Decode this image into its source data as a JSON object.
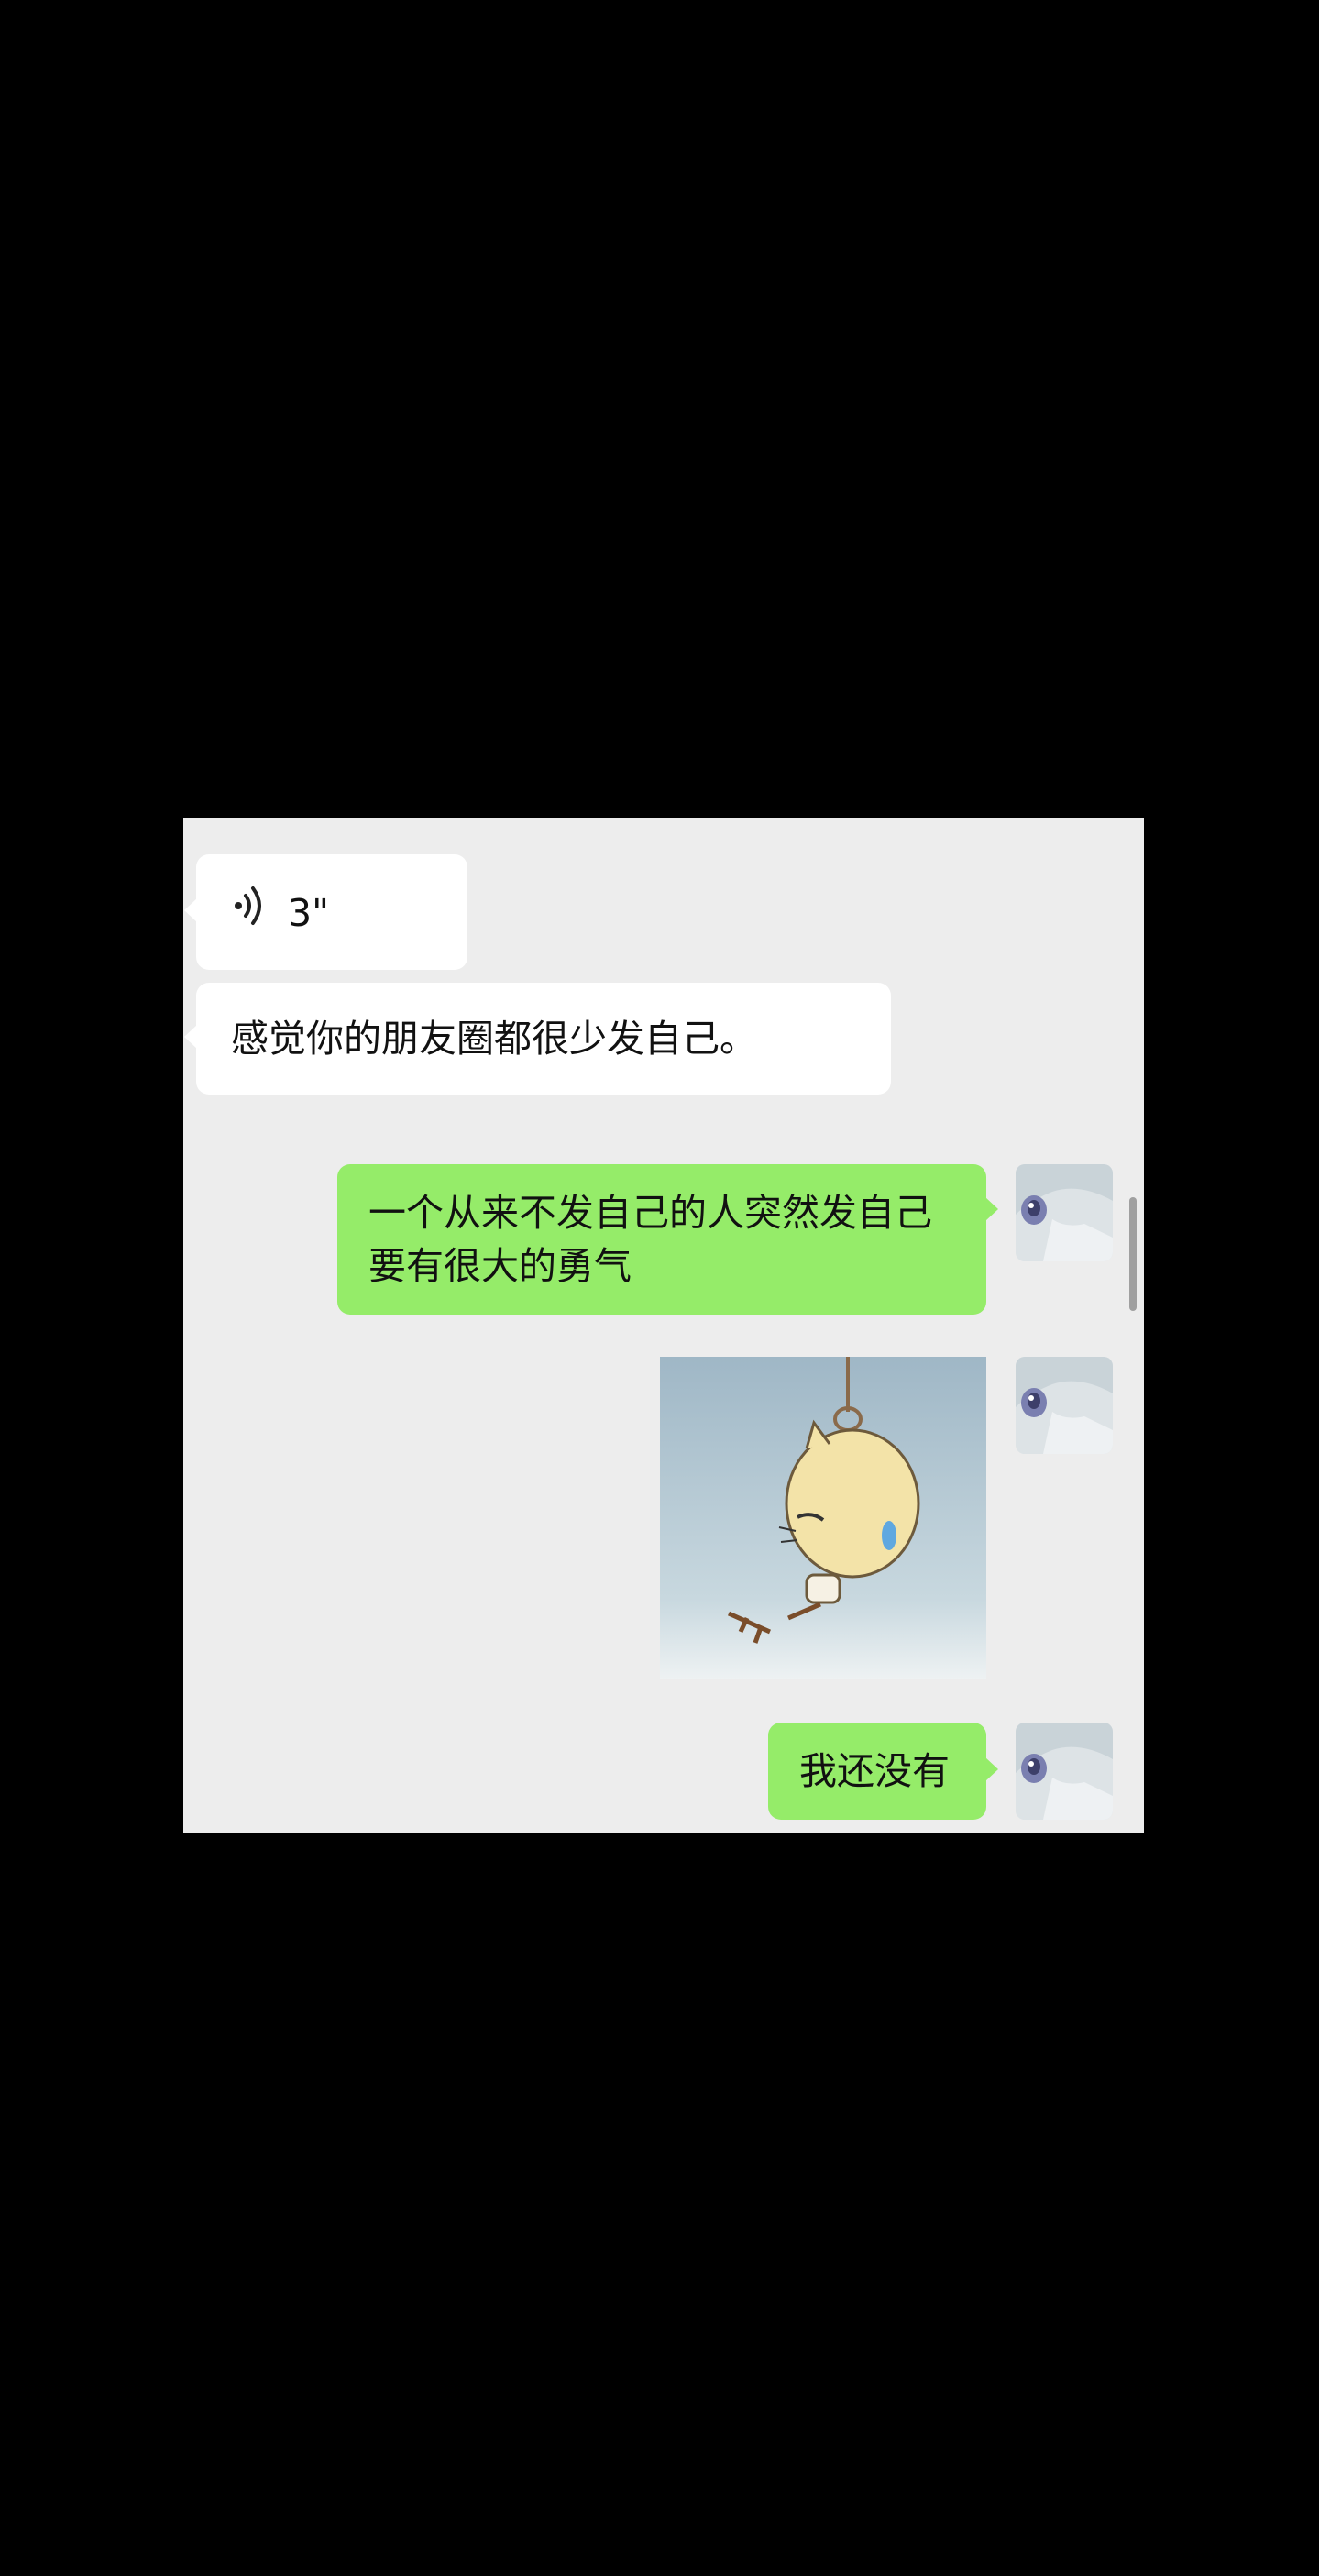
{
  "messages": {
    "voice": {
      "duration": "3\"",
      "icon": "voice-wave-icon"
    },
    "incoming_text": "感觉你的朋友圈都很少发自己。",
    "outgoing_text_1_line1": "一个从来不发自己的人突然发自己",
    "outgoing_text_1_line2": "要有很大的勇气",
    "sticker": {
      "icon": "hanging-cat-sticker"
    },
    "outgoing_text_2": "我还没有"
  },
  "colors": {
    "background": "#000000",
    "chat_background": "#ededed",
    "incoming_bubble": "#ffffff",
    "outgoing_bubble": "#95ec69"
  }
}
